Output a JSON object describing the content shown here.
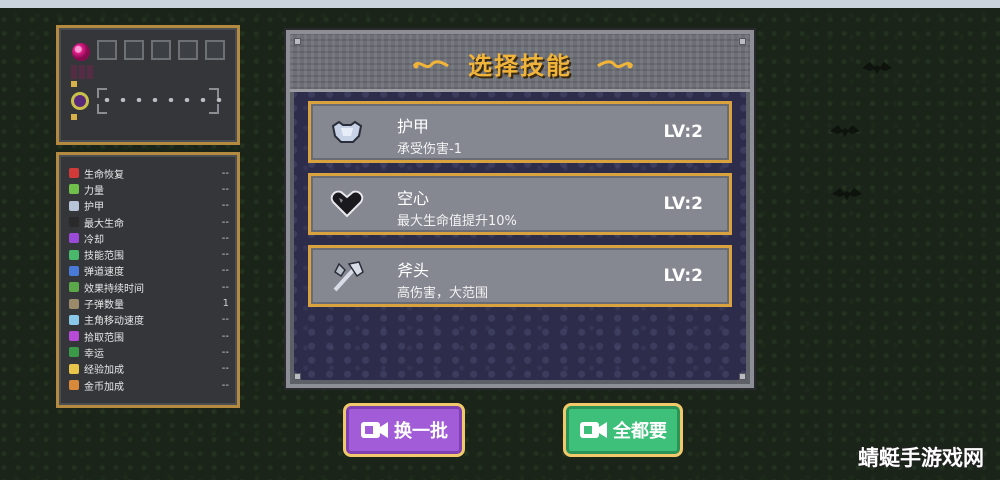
{
  "dialog": {
    "title": "选择技能",
    "skills": [
      {
        "name": "护甲",
        "desc": "承受伤害-1",
        "level": "LV:2",
        "icon": "armor-icon"
      },
      {
        "name": "空心",
        "desc": "最大生命值提升10%",
        "level": "LV:2",
        "icon": "heart-icon"
      },
      {
        "name": "斧头",
        "desc": "高伤害，大范围",
        "level": "LV:2",
        "icon": "axe-icon"
      }
    ]
  },
  "buttons": {
    "refresh_label": "换一批",
    "take_all_label": "全都要"
  },
  "stats": [
    {
      "label": "生命恢复",
      "value": "--",
      "color": "#d23a3a"
    },
    {
      "label": "力量",
      "value": "--",
      "color": "#6fbf4a"
    },
    {
      "label": "护甲",
      "value": "--",
      "color": "#b8c4d8"
    },
    {
      "label": "最大生命",
      "value": "--",
      "color": "#2a2a2a"
    },
    {
      "label": "冷却",
      "value": "--",
      "color": "#9a4ad8"
    },
    {
      "label": "技能范围",
      "value": "--",
      "color": "#4ab86a"
    },
    {
      "label": "弹道速度",
      "value": "--",
      "color": "#4a7ad8"
    },
    {
      "label": "效果持续时间",
      "value": "--",
      "color": "#5aa84a"
    },
    {
      "label": "子弹数量",
      "value": "1",
      "color": "#9a8a6a"
    },
    {
      "label": "主角移动速度",
      "value": "--",
      "color": "#8ac8e8"
    },
    {
      "label": "拾取范围",
      "value": "--",
      "color": "#b84ad8"
    },
    {
      "label": "幸运",
      "value": "--",
      "color": "#3a9a4a"
    },
    {
      "label": "经验加成",
      "value": "--",
      "color": "#e8c44a"
    },
    {
      "label": "金币加成",
      "value": "--",
      "color": "#d88a3a"
    }
  ],
  "colors": {
    "accent_gold": "#f0b43a",
    "card_border": "#d9a23f",
    "refresh_button": "#a35cd8",
    "take_all_button": "#3fc07a"
  },
  "watermark": "蜻蜓手游戏网"
}
